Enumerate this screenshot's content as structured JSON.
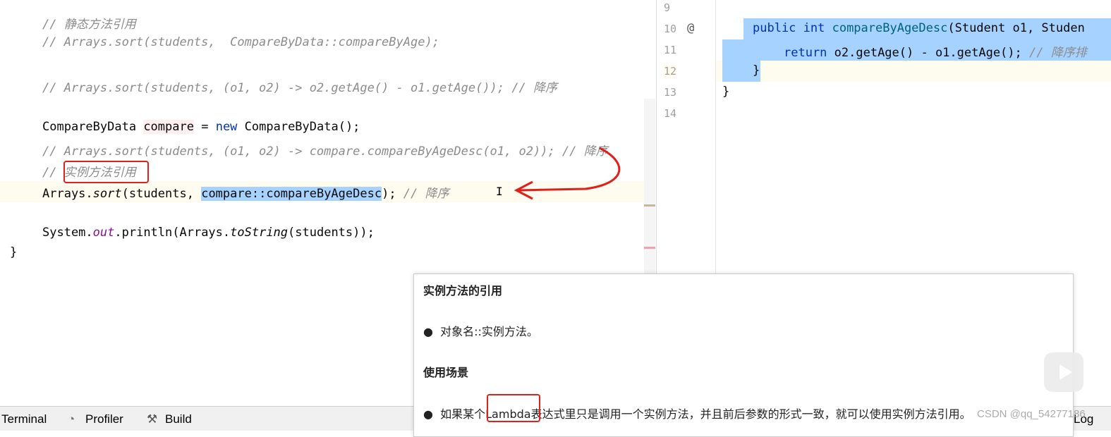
{
  "editor_left": {
    "lines": [
      "// 静态方法引用",
      "// Arrays.sort(students,  CompareByData::compareByAge);",
      "// Arrays.sort(students, (o1, o2) -> o2.getAge() - o1.getAge()); // 降序",
      "CompareByData",
      "compare",
      "= ",
      "new",
      " CompareByData();",
      "// Arrays.sort(students, (o1, o2) -> compare.compareByAgeDesc(o1, o2)); // 降序",
      "// ",
      "实例方法引用",
      "Arrays.",
      "sort",
      "(students, ",
      "compare::compareByAgeDesc",
      "); ",
      "// 降序",
      "System.",
      "out",
      ".println(Arrays.",
      "toString",
      "(students));",
      "}"
    ]
  },
  "editor_right": {
    "line_numbers": [
      "9",
      "10",
      "11",
      "12",
      "13",
      "14"
    ],
    "override_marker": "@",
    "line10": [
      "public int ",
      "compareByAgeDesc",
      "(Student o1, Studen"
    ],
    "line11": [
      "return ",
      "o2.getAge() - o1.getAge(); ",
      "// 降序排"
    ],
    "line12": "}",
    "line13": "}"
  },
  "popup": {
    "title1": "实例方法的引用",
    "item1": "对象名::实例方法。",
    "title2": "使用场景",
    "item2": "如果某个Lambda表达式里只是调用一个实例方法，并且前后参数的形式一致，就可以使用实例方法引用。"
  },
  "bottom_bar": {
    "terminal": "Terminal",
    "profiler": "Profiler",
    "build": "Build",
    "log": "Log"
  },
  "watermark": "CSDN @qq_54277186",
  "colors": {
    "selection": "#a6d2ff",
    "annotation": "#e0201a",
    "keyword": "#0033b3"
  }
}
